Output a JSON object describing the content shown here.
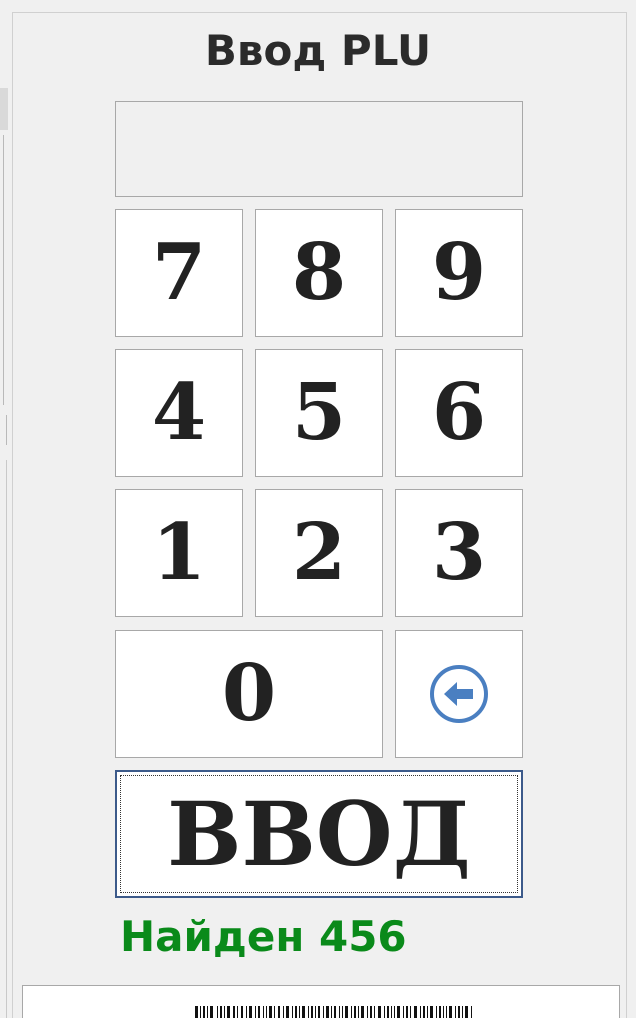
{
  "panel": {
    "title": "Ввод PLU",
    "plu_input_value": ""
  },
  "keypad": {
    "keys": [
      "7",
      "8",
      "9",
      "4",
      "5",
      "6",
      "1",
      "2",
      "3",
      "0"
    ],
    "backspace_icon": "arrow-left-circle-icon"
  },
  "enter_button": {
    "label": "ВВОД"
  },
  "status": {
    "text": "Найден 456",
    "color": "#0a8a1a"
  },
  "colors": {
    "background": "#f0f0f0",
    "key_background": "#ffffff",
    "backspace_icon": "#4a7fc1",
    "focus_border": "#3c5a8a"
  }
}
